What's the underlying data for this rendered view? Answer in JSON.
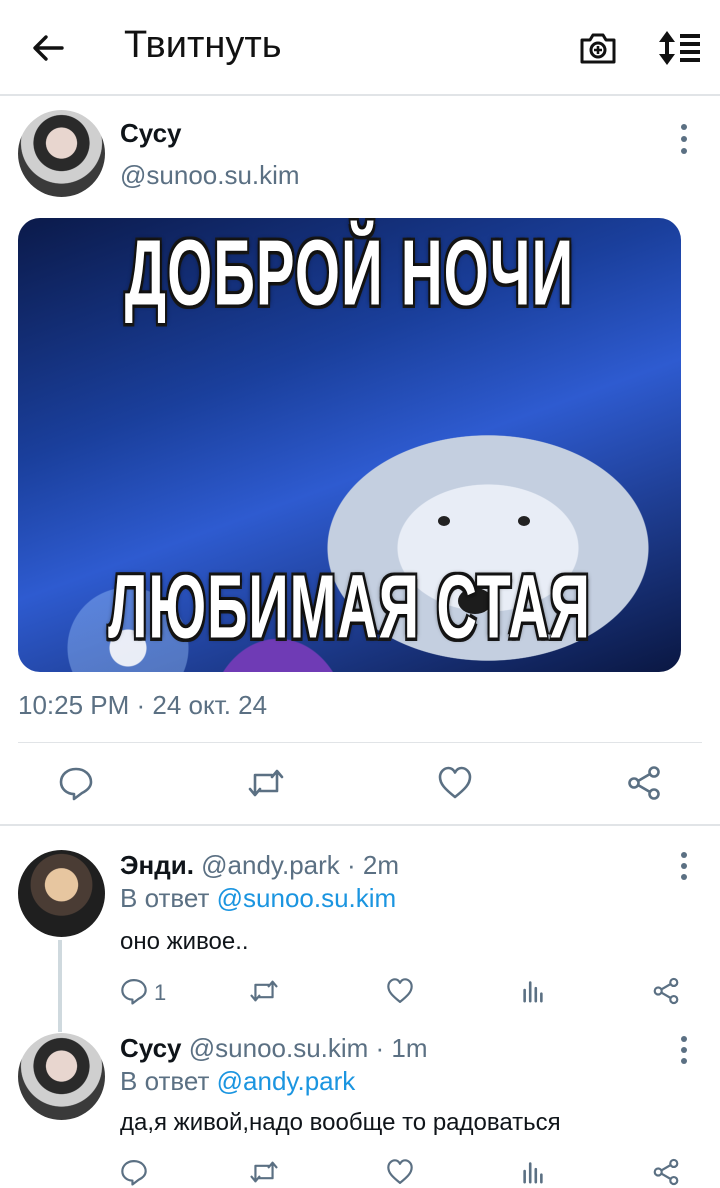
{
  "header": {
    "title": "Твитнуть"
  },
  "main_tweet": {
    "name": "Сусу",
    "handle": "@sunoo.su.kim",
    "media_caption_top": "ДОБРОЙ НОЧИ",
    "media_caption_bottom": "ЛЮБИМАЯ СТАЯ",
    "timestamp": "10:25 PM · 24 окт. 24"
  },
  "replies": [
    {
      "name": "Энди.",
      "meta": "@andy.park · 2m",
      "reply_prefix": "В ответ ",
      "reply_to": "@sunoo.su.kim",
      "text": "оно живое..",
      "reply_count": "1"
    },
    {
      "name": "Сусу",
      "meta": "@sunoo.su.kim · 1m",
      "reply_prefix": "В ответ ",
      "reply_to": "@andy.park",
      "text": "да,я живой,надо вообще то радоваться",
      "reply_count": ""
    }
  ],
  "colors": {
    "link": "#1b95e0",
    "secondary_text": "#5b7083",
    "divider": "#e1e4e7"
  },
  "icons": [
    "back-arrow-icon",
    "camera-icon",
    "sort-icon",
    "more-icon",
    "reply-icon",
    "retweet-icon",
    "like-icon",
    "share-icon",
    "analytics-icon"
  ]
}
